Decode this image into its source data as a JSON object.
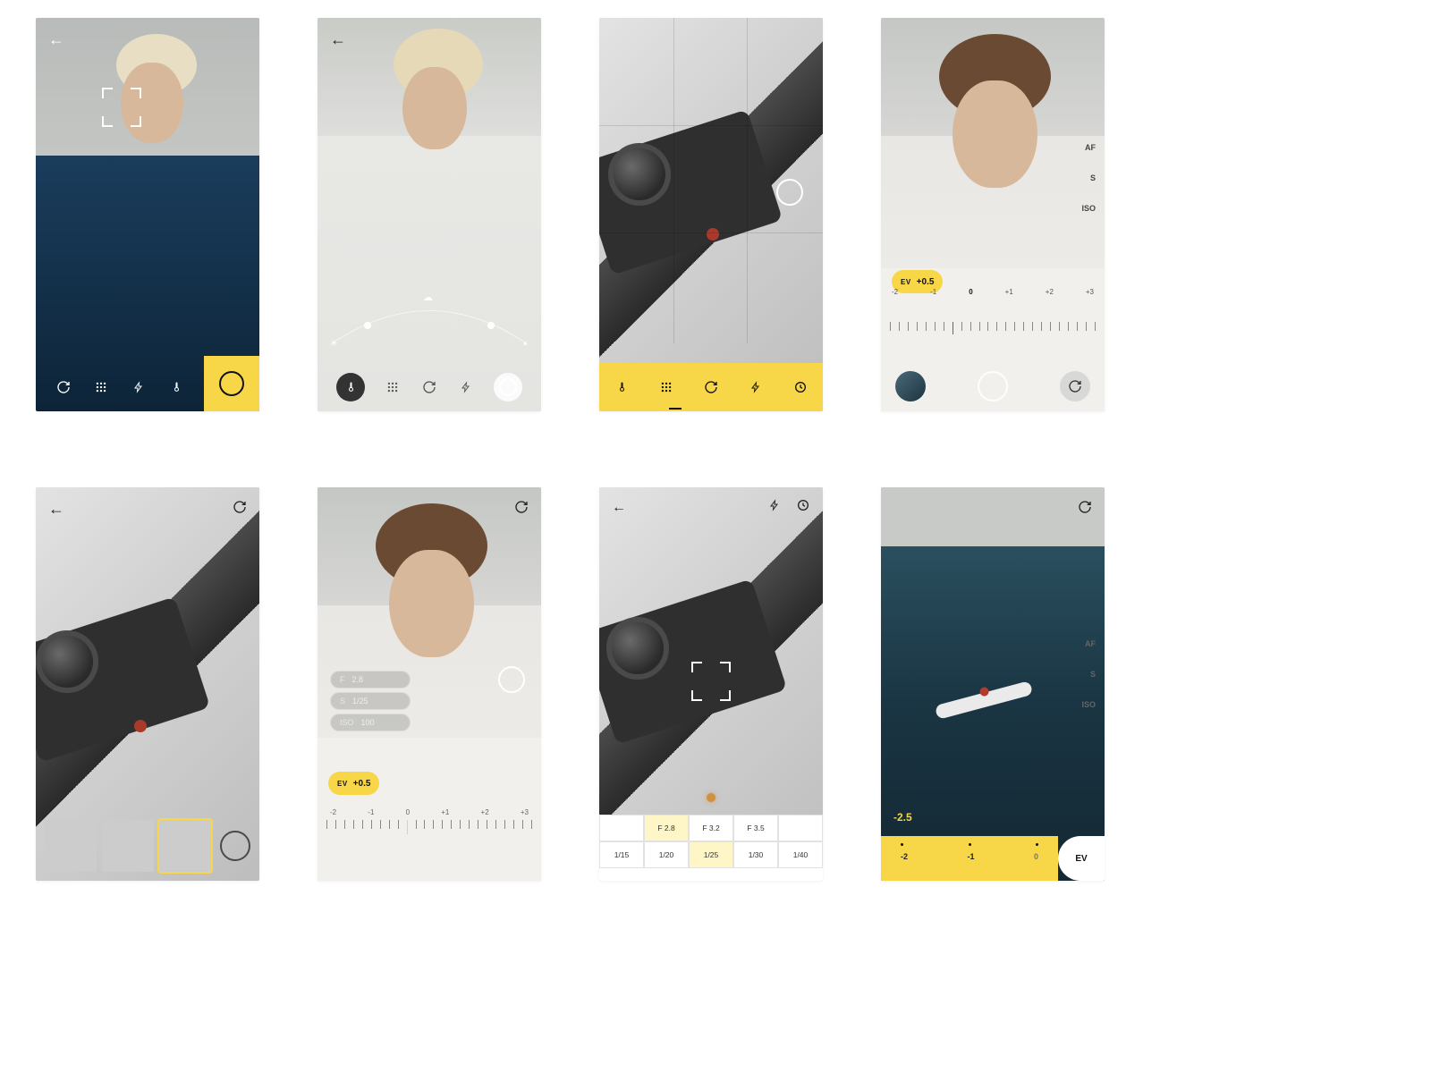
{
  "colors": {
    "accent": "#f7d648",
    "danger": "#d43a2a"
  },
  "icons": {
    "back": "←",
    "refresh": "↻",
    "grid": "⋮⋮",
    "flash": "⚡",
    "temp": "🌡",
    "timer": "◷",
    "sun": "☀",
    "cloud": "☁",
    "moon": "◐"
  },
  "screen1": {
    "toolbar_icons": [
      "refresh",
      "grid",
      "flash",
      "temp"
    ]
  },
  "screen2": {
    "toolbar_icons": [
      "temp",
      "grid",
      "refresh",
      "flash"
    ],
    "arc_icons": [
      "sun",
      "cloud",
      "moon"
    ]
  },
  "screen3": {
    "bar_icons": [
      "temp",
      "grid",
      "refresh",
      "flash",
      "timer"
    ]
  },
  "screen4": {
    "side_labels": [
      "AF",
      "S",
      "ISO"
    ],
    "ev": {
      "label": "EV",
      "value": "+0.5"
    },
    "ruler": [
      "-2",
      "-1",
      "0",
      "+1",
      "+2",
      "+3"
    ]
  },
  "screen5": {},
  "screen6": {
    "readout": [
      {
        "k": "F",
        "v": "2.8"
      },
      {
        "k": "S",
        "v": "1/25"
      },
      {
        "k": "ISO",
        "v": "100"
      }
    ],
    "ev": {
      "label": "EV",
      "value": "+0.5"
    },
    "ruler": [
      "-2",
      "-1",
      "0",
      "+1",
      "+2",
      "+3"
    ]
  },
  "screen7": {
    "top_icons": [
      "flash",
      "timer"
    ],
    "fstops": [
      "",
      "F 2.8",
      "F 3.2",
      "F 3.5"
    ],
    "shutter": [
      "1/15",
      "1/20",
      "1/25",
      "1/30",
      "1/40"
    ],
    "selected_f": "F 2.8",
    "selected_s": "1/25"
  },
  "screen8": {
    "side_labels": [
      "AF",
      "S",
      "ISO"
    ],
    "ev_value": "-2.5",
    "ruler": [
      "-2",
      "-1",
      "0"
    ],
    "ev_label": "EV"
  }
}
